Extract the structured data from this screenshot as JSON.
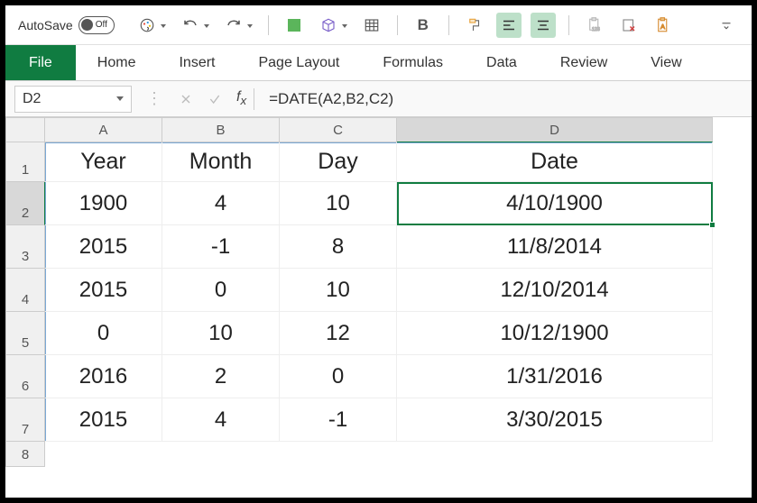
{
  "qat": {
    "autosave_label": "AutoSave",
    "autosave_state": "Off"
  },
  "ribbon": {
    "file": "File",
    "tabs": [
      "Home",
      "Insert",
      "Page Layout",
      "Formulas",
      "Data",
      "Review",
      "View"
    ]
  },
  "formula_bar": {
    "name_box": "D2",
    "formula": "=DATE(A2,B2,C2)"
  },
  "columns": [
    "A",
    "B",
    "C",
    "D"
  ],
  "rows": [
    "1",
    "2",
    "3",
    "4",
    "5",
    "6",
    "7",
    "8"
  ],
  "cells": {
    "A1": "Year",
    "B1": "Month",
    "C1": "Day",
    "D1": "Date",
    "A2": "1900",
    "B2": "4",
    "C2": "10",
    "D2": "4/10/1900",
    "A3": "2015",
    "B3": "-1",
    "C3": "8",
    "D3": "11/8/2014",
    "A4": "2015",
    "B4": "0",
    "C4": "10",
    "D4": "12/10/2014",
    "A5": "0",
    "B5": "10",
    "C5": "12",
    "D5": "10/12/1900",
    "A6": "2016",
    "B6": "2",
    "C6": "0",
    "D6": "1/31/2016",
    "A7": "2015",
    "B7": "4",
    "C7": "-1",
    "D7": "3/30/2015"
  },
  "selected_cell": "D2",
  "chart_data": {
    "type": "table",
    "columns": [
      "Year",
      "Month",
      "Day",
      "Date"
    ],
    "rows": [
      [
        1900,
        4,
        10,
        "4/10/1900"
      ],
      [
        2015,
        -1,
        8,
        "11/8/2014"
      ],
      [
        2015,
        0,
        10,
        "12/10/2014"
      ],
      [
        0,
        10,
        12,
        "10/12/1900"
      ],
      [
        2016,
        2,
        0,
        "1/31/2016"
      ],
      [
        2015,
        4,
        -1,
        "3/30/2015"
      ]
    ]
  }
}
